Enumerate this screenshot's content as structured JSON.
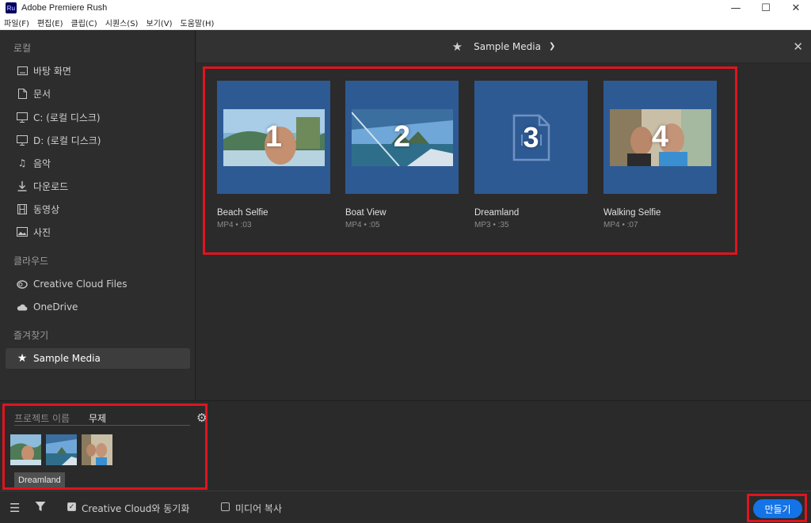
{
  "window": {
    "title": "Adobe Premiere Rush",
    "app_icon": "Ru",
    "controls": [
      "minimize-icon",
      "maximize-icon",
      "close-icon"
    ]
  },
  "menu": [
    "파일(F)",
    "편집(E)",
    "클립(C)",
    "시퀀스(S)",
    "보기(V)",
    "도움말(H)"
  ],
  "sidebar": {
    "local_title": "로컬",
    "local_items": [
      {
        "label": "바탕 화면",
        "icon": "desktop-icon"
      },
      {
        "label": "문서",
        "icon": "document-icon"
      },
      {
        "label": "C: (로컬 디스크)",
        "icon": "monitor-icon"
      },
      {
        "label": "D: (로컬 디스크)",
        "icon": "monitor-icon"
      },
      {
        "label": "음악",
        "icon": "music-icon"
      },
      {
        "label": "다운로드",
        "icon": "download-icon"
      },
      {
        "label": "동영상",
        "icon": "film-icon"
      },
      {
        "label": "사진",
        "icon": "image-icon"
      }
    ],
    "cloud_title": "클라우드",
    "cloud_items": [
      {
        "label": "Creative Cloud Files",
        "icon": "creative-cloud-icon"
      },
      {
        "label": "OneDrive",
        "icon": "cloud-icon"
      }
    ],
    "favorites_title": "즐겨찾기",
    "favorites_items": [
      {
        "label": "Sample Media",
        "icon": "star-icon",
        "selected": true
      }
    ]
  },
  "main": {
    "header_title": "Sample Media",
    "header_icon": "star-icon",
    "media": [
      {
        "number": "1",
        "name": "Beach Selfie",
        "meta": "MP4 • :03",
        "kind": "video"
      },
      {
        "number": "2",
        "name": "Boat View",
        "meta": "MP4 • :05",
        "kind": "video"
      },
      {
        "number": "3",
        "name": "Dreamland",
        "meta": "MP3 • :35",
        "kind": "audio"
      },
      {
        "number": "4",
        "name": "Walking Selfie",
        "meta": "MP4 • :07",
        "kind": "video"
      }
    ]
  },
  "project": {
    "label": "프로젝트 이름",
    "name": "무제",
    "audio_tag": "Dreamland"
  },
  "footer": {
    "sync_label": "Creative Cloud와 동기화",
    "sync_checked": true,
    "copy_label": "미디어 복사",
    "copy_checked": false,
    "create_label": "만들기"
  },
  "colors": {
    "accent": "#1473e6",
    "card_bg": "#2e5a94",
    "highlight": "#e0141e"
  }
}
